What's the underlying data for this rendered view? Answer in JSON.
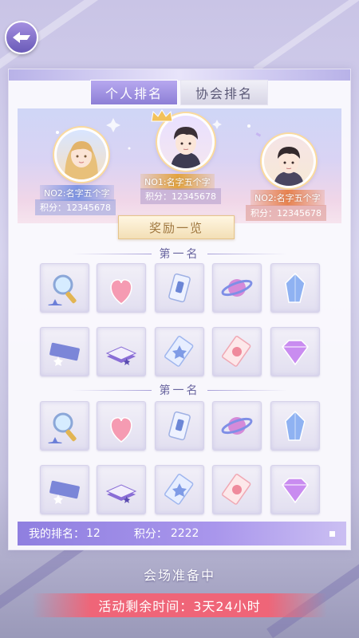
{
  "tabs": [
    {
      "label": "个人排名"
    },
    {
      "label": "协会排名"
    }
  ],
  "podium": [
    {
      "rank_name": "NO2:名字五个字",
      "score": "积分：12345678",
      "position": "left",
      "accent": "#6f8ee0"
    },
    {
      "rank_name": "NO1:名字五个字",
      "score": "积分：12345678",
      "position": "center",
      "accent": "#e3a33e"
    },
    {
      "rank_name": "NO2:名字五个字",
      "score": "积分：12345678",
      "position": "right",
      "accent": "#e8834f"
    }
  ],
  "reward_button": "奖励一览",
  "sections": [
    {
      "title": "第一名",
      "items": [
        "magnifier-icon",
        "heart-gem-icon",
        "potion-card-icon",
        "planet-orb-icon",
        "crystal-icon",
        "ticket-icon",
        "book-icon",
        "star-card-icon",
        "rose-card-icon",
        "diamond-icon"
      ]
    },
    {
      "title": "第一名",
      "items": [
        "magnifier-icon",
        "heart-gem-icon",
        "potion-card-icon",
        "planet-orb-icon",
        "crystal-icon",
        "ticket-icon",
        "book-icon",
        "star-card-icon",
        "rose-card-icon",
        "diamond-icon"
      ]
    }
  ],
  "my_rank": {
    "label": "我的排名：",
    "value": "12",
    "score_label": "积分：",
    "score_value": "2222"
  },
  "status_text": "会场准备中",
  "countdown_text": "活动剩余时间：3天24小时"
}
